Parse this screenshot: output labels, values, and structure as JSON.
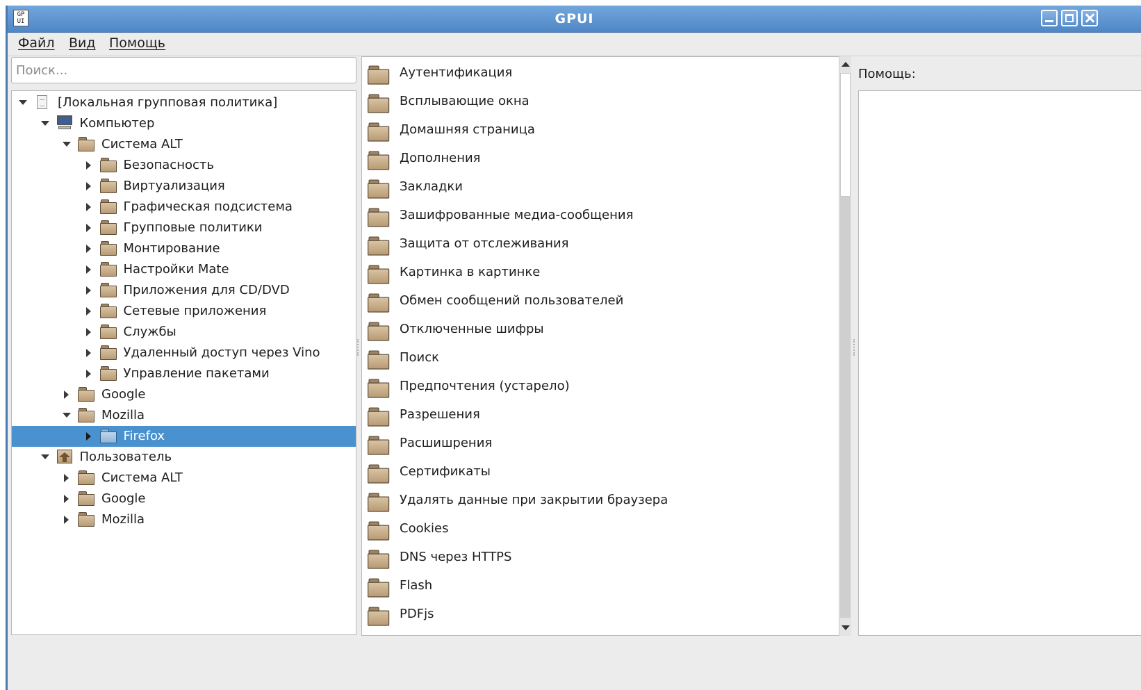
{
  "window": {
    "title": "GPUI",
    "app_icon_text": "GP\nUI",
    "controls": [
      "minimize-icon",
      "maximize-icon",
      "close-icon"
    ]
  },
  "menubar": {
    "file": "Файл",
    "view": "Вид",
    "help": "Помощь"
  },
  "search": {
    "placeholder": "Поиск..."
  },
  "tree": {
    "items": [
      {
        "label": "[Локальная групповая политика]",
        "level": 0,
        "expanded": true,
        "icon": "document-icon"
      },
      {
        "label": "Компьютер",
        "level": 1,
        "expanded": true,
        "icon": "computer-icon"
      },
      {
        "label": "Система ALT",
        "level": 2,
        "expanded": true,
        "icon": "folder-icon"
      },
      {
        "label": "Безопасность",
        "level": 3,
        "expanded": false,
        "icon": "folder-icon"
      },
      {
        "label": "Виртуализация",
        "level": 3,
        "expanded": false,
        "icon": "folder-icon"
      },
      {
        "label": "Графическая подсистема",
        "level": 3,
        "expanded": false,
        "icon": "folder-icon"
      },
      {
        "label": "Групповые политики",
        "level": 3,
        "expanded": false,
        "icon": "folder-icon"
      },
      {
        "label": "Монтирование",
        "level": 3,
        "expanded": false,
        "icon": "folder-icon"
      },
      {
        "label": "Настройки Mate",
        "level": 3,
        "expanded": false,
        "icon": "folder-icon"
      },
      {
        "label": "Приложения для CD/DVD",
        "level": 3,
        "expanded": false,
        "icon": "folder-icon"
      },
      {
        "label": "Сетевые приложения",
        "level": 3,
        "expanded": false,
        "icon": "folder-icon"
      },
      {
        "label": "Службы",
        "level": 3,
        "expanded": false,
        "icon": "folder-icon"
      },
      {
        "label": "Удаленный доступ через Vino",
        "level": 3,
        "expanded": false,
        "icon": "folder-icon"
      },
      {
        "label": "Управление пакетами",
        "level": 3,
        "expanded": false,
        "icon": "folder-icon"
      },
      {
        "label": "Google",
        "level": 2,
        "expanded": false,
        "icon": "folder-icon"
      },
      {
        "label": "Mozilla",
        "level": 2,
        "expanded": true,
        "icon": "folder-icon"
      },
      {
        "label": "Firefox",
        "level": 3,
        "expanded": false,
        "icon": "folder-icon",
        "selected": true
      },
      {
        "label": "Пользователь",
        "level": 1,
        "expanded": true,
        "icon": "home-icon"
      },
      {
        "label": "Система ALT",
        "level": 2,
        "expanded": false,
        "icon": "folder-icon"
      },
      {
        "label": "Google",
        "level": 2,
        "expanded": false,
        "icon": "folder-icon"
      },
      {
        "label": "Mozilla",
        "level": 2,
        "expanded": false,
        "icon": "folder-icon"
      }
    ]
  },
  "content": {
    "items": [
      "Аутентификация",
      "Всплывающие окна",
      "Домашняя страница",
      "Дополнения",
      "Закладки",
      "Зашифрованные медиа-сообщения",
      "Защита от отслеживания",
      "Картинка в картинке",
      "Обмен сообщений пользователей",
      "Отключенные шифры",
      "Поиск",
      "Предпочтения (устарело)",
      "Разрешения",
      "Расшишрения",
      "Сертификаты",
      "Удалять данные при закрытии браузера",
      "Cookies",
      "DNS через HTTPS",
      "Flash",
      "PDFjs"
    ]
  },
  "help": {
    "label": "Помощь:"
  },
  "colors": {
    "titlebar": "#5a91cf",
    "selection": "#4a91cf",
    "folder": "#c9b08c"
  }
}
